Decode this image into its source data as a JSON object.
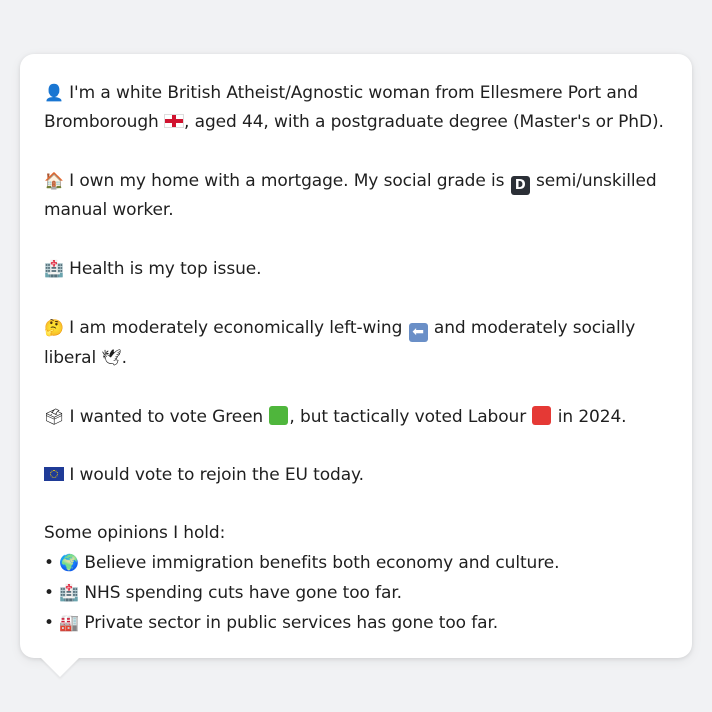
{
  "profile": {
    "identity": {
      "icon": "👤",
      "text_1": "I'm a white British Atheist/Agnostic woman from Ellesmere Port and Bromborough",
      "flag": "england-flag-icon",
      "text_2": ", aged 44, with a postgraduate degree (Master's or PhD)."
    },
    "home": {
      "icon": "🏠",
      "text_1": "I own my home with a mortgage. My social grade is",
      "grade_badge": "D",
      "text_2": "semi/unskilled manual worker."
    },
    "health": {
      "icon": "🏥",
      "text": "Health is my top issue."
    },
    "politics": {
      "icon": "🤔",
      "text_1": "I am moderately economically left-wing",
      "left_arrow": "⬅",
      "text_2": "and moderately socially liberal",
      "dove": "🕊",
      "text_3": "."
    },
    "vote": {
      "icon": "🗳",
      "text_1": "I wanted to vote Green",
      "text_2": ", but tactically voted Labour",
      "text_3": "in 2024."
    },
    "eu": {
      "icon": "eu-flag-icon",
      "text": "I would vote to rejoin the EU today."
    },
    "opinions": {
      "heading": "Some opinions I hold:",
      "items": [
        {
          "bullet": "•",
          "icon": "🌍",
          "text": "Believe immigration benefits both economy and culture."
        },
        {
          "bullet": "•",
          "icon": "🏥",
          "text": "NHS spending cuts have gone too far."
        },
        {
          "bullet": "•",
          "icon": "🏭",
          "text": "Private sector in public services has gone too far."
        }
      ]
    }
  },
  "colors": {
    "green_square": "#4fb63c",
    "red_square": "#e53935",
    "card_background": "#ffffff",
    "page_background": "#f1f2f4"
  }
}
